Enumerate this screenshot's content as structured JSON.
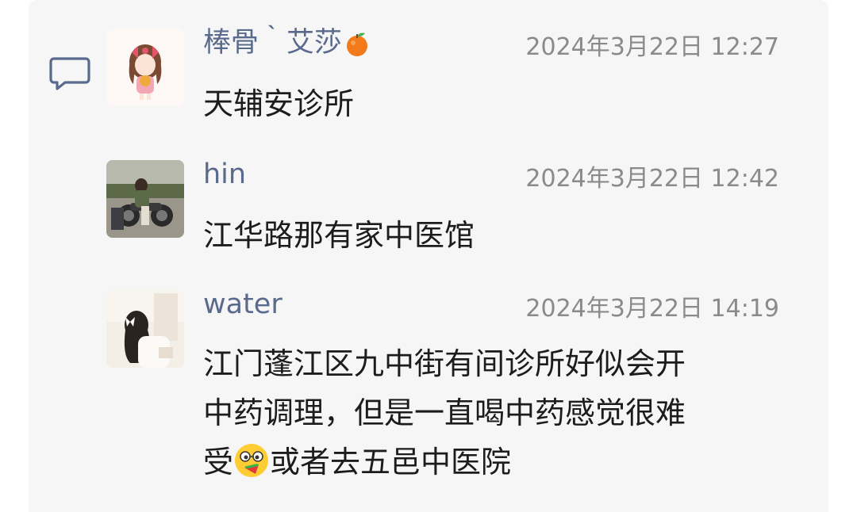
{
  "comments": [
    {
      "name": "棒骨｀艾莎",
      "time": "2024年3月22日 12:27",
      "text": "天辅安诊所"
    },
    {
      "name": "hin",
      "time": "2024年3月22日 12:42",
      "text": "江华路那有家中医馆"
    },
    {
      "name": "water",
      "time": "2024年3月22日 14:19",
      "text_line1": "江门蓬江区九中街有间诊所好似会开",
      "text_line2": "中药调理，但是一直喝中药感觉很难",
      "text_line3_a": "受",
      "text_line3_b": "或者去五邑中医院"
    }
  ],
  "icons": {
    "comment": "comment-bubble-icon",
    "name_emoji": "tangerine-icon",
    "inline_emoji": "face-emoji-icon"
  },
  "colors": {
    "name": "#5a6a8c",
    "time": "#8a8a8a",
    "text": "#1c1c1c",
    "panel": "#f6f6f6"
  }
}
